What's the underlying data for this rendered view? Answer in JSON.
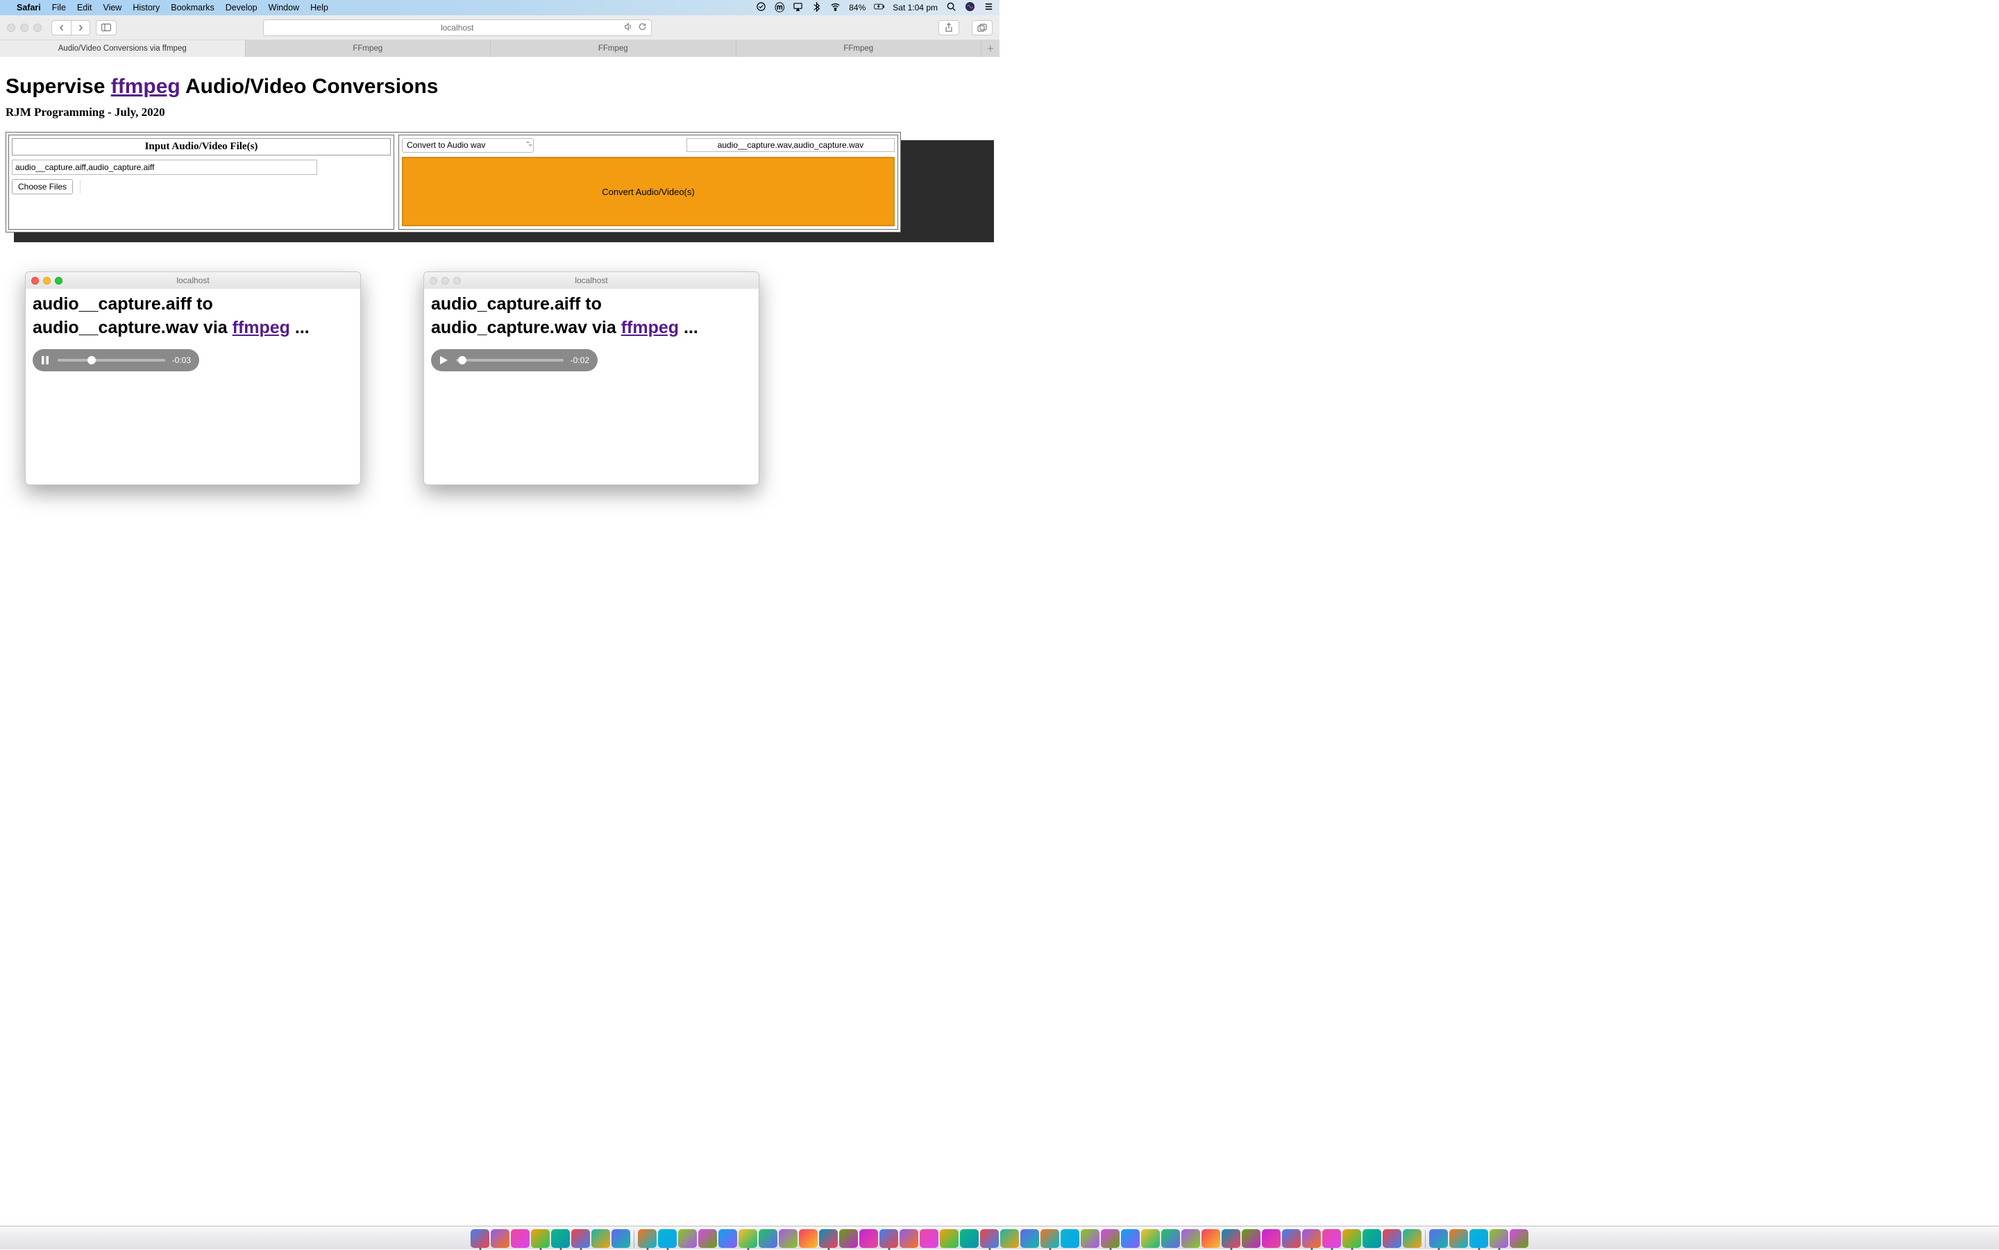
{
  "menubar": {
    "app": "Safari",
    "items": [
      "File",
      "Edit",
      "View",
      "History",
      "Bookmarks",
      "Develop",
      "Window",
      "Help"
    ],
    "battery_pct": "84%",
    "clock": "Sat 1:04 pm"
  },
  "toolbar": {
    "address": "localhost"
  },
  "tabs": {
    "items": [
      {
        "label": "Audio/Video Conversions via ffmpeg",
        "active": true
      },
      {
        "label": "FFmpeg",
        "active": false
      },
      {
        "label": "FFmpeg",
        "active": false
      },
      {
        "label": "FFmpeg",
        "active": false
      }
    ]
  },
  "page": {
    "title_pre": "Supervise ",
    "title_link": "ffmpeg",
    "title_post": " Audio/Video Conversions",
    "subtitle": "RJM Programming - July, 2020",
    "input_header": "Input Audio/Video File(s)",
    "input_value": "audio__capture.aiff,audio_capture.aiff",
    "choose_label": "Choose Files",
    "select_value": "Convert to Audio wav",
    "output_value": "audio__capture.wav,audio_capture.wav",
    "convert_label": "Convert Audio/Video(s)"
  },
  "popups": [
    {
      "active": true,
      "title": "localhost",
      "heading_pre": "audio__capture.aiff to audio__capture.wav via ",
      "heading_link": "ffmpeg",
      "heading_post": " ...",
      "playing": true,
      "progress_pct": 28,
      "time": "-0:03"
    },
    {
      "active": false,
      "title": "localhost",
      "heading_pre": "audio_capture.aiff to audio_capture.wav via ",
      "heading_link": "ffmpeg",
      "heading_post": " ...",
      "playing": false,
      "progress_pct": 2,
      "time": "-0:02"
    }
  ],
  "dock": {
    "count": 52,
    "separators_after": [
      7,
      46
    ]
  }
}
